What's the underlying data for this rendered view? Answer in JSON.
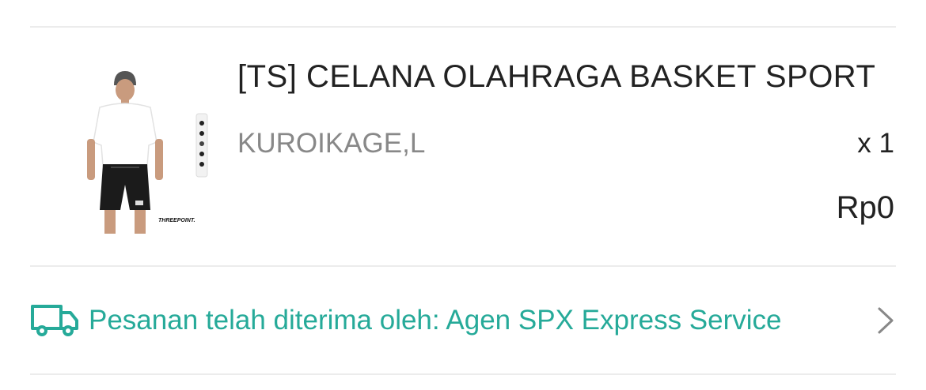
{
  "product": {
    "name": "[TS] CELANA OLAHRAGA BASKET SPORT",
    "variant": "KUROIKAGE,L",
    "quantity": "x 1",
    "price": "Rp0",
    "image_brand_text": "THREEPOINT."
  },
  "shipping": {
    "status_text": "Pesanan telah diterima oleh: Agen SPX Express Service",
    "icon": "truck-icon",
    "accent_color": "#26aa99"
  }
}
